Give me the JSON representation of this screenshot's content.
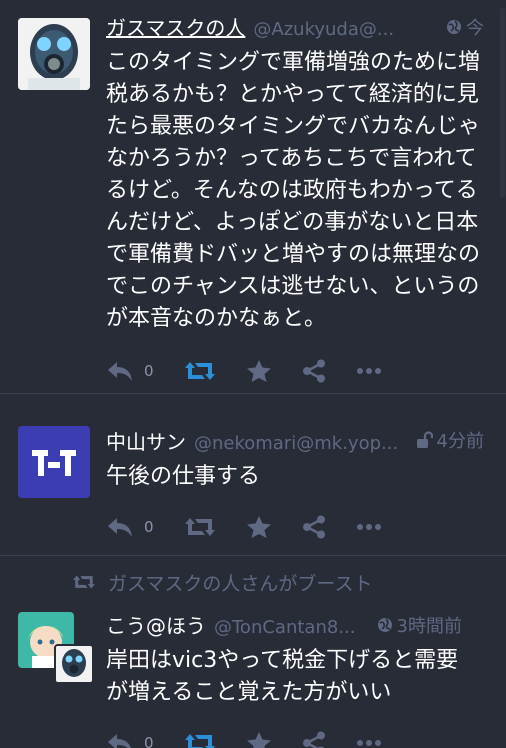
{
  "statuses": [
    {
      "display_name": "ガスマスクの人",
      "acct": "@Azukyuda@...",
      "visibility_icon": "globe-icon",
      "time": "今",
      "content": "このタイミングで軍備増強のために増税あるかも？とかやってて経済的に見たら最悪のタイミングでバカなんじゃなかろうか？ってあちこちで言われてるけど。そんなのは政府もわかってるんだけど、よっぽどの事がないと日本で軍備費ドバッと増やすのは無理なのでこのチャンスは逃せない、というのが本音なのかなぁと。",
      "reply_count": "0",
      "boosted": true
    },
    {
      "display_name": "中山サン",
      "acct": "@nekomari@mk.yop...",
      "visibility_icon": "lock-open-icon",
      "time": "4分前",
      "content": "午後の仕事する",
      "reply_count": "0",
      "boosted": false
    },
    {
      "boost_prepend": "ガスマスクの人さんがブースト",
      "display_name": "こう@ほう",
      "acct": "@TonCantan8...",
      "visibility_icon": "globe-icon",
      "time": "3時間前",
      "content": "岸田はvic3やって税金下げると需要が増えること覚えた方がいい",
      "reply_count": "0",
      "boosted": true
    }
  ],
  "colors": {
    "background": "#282c37",
    "muted": "#606984",
    "boost_active": "#2b90d9",
    "text": "#ffffff"
  }
}
